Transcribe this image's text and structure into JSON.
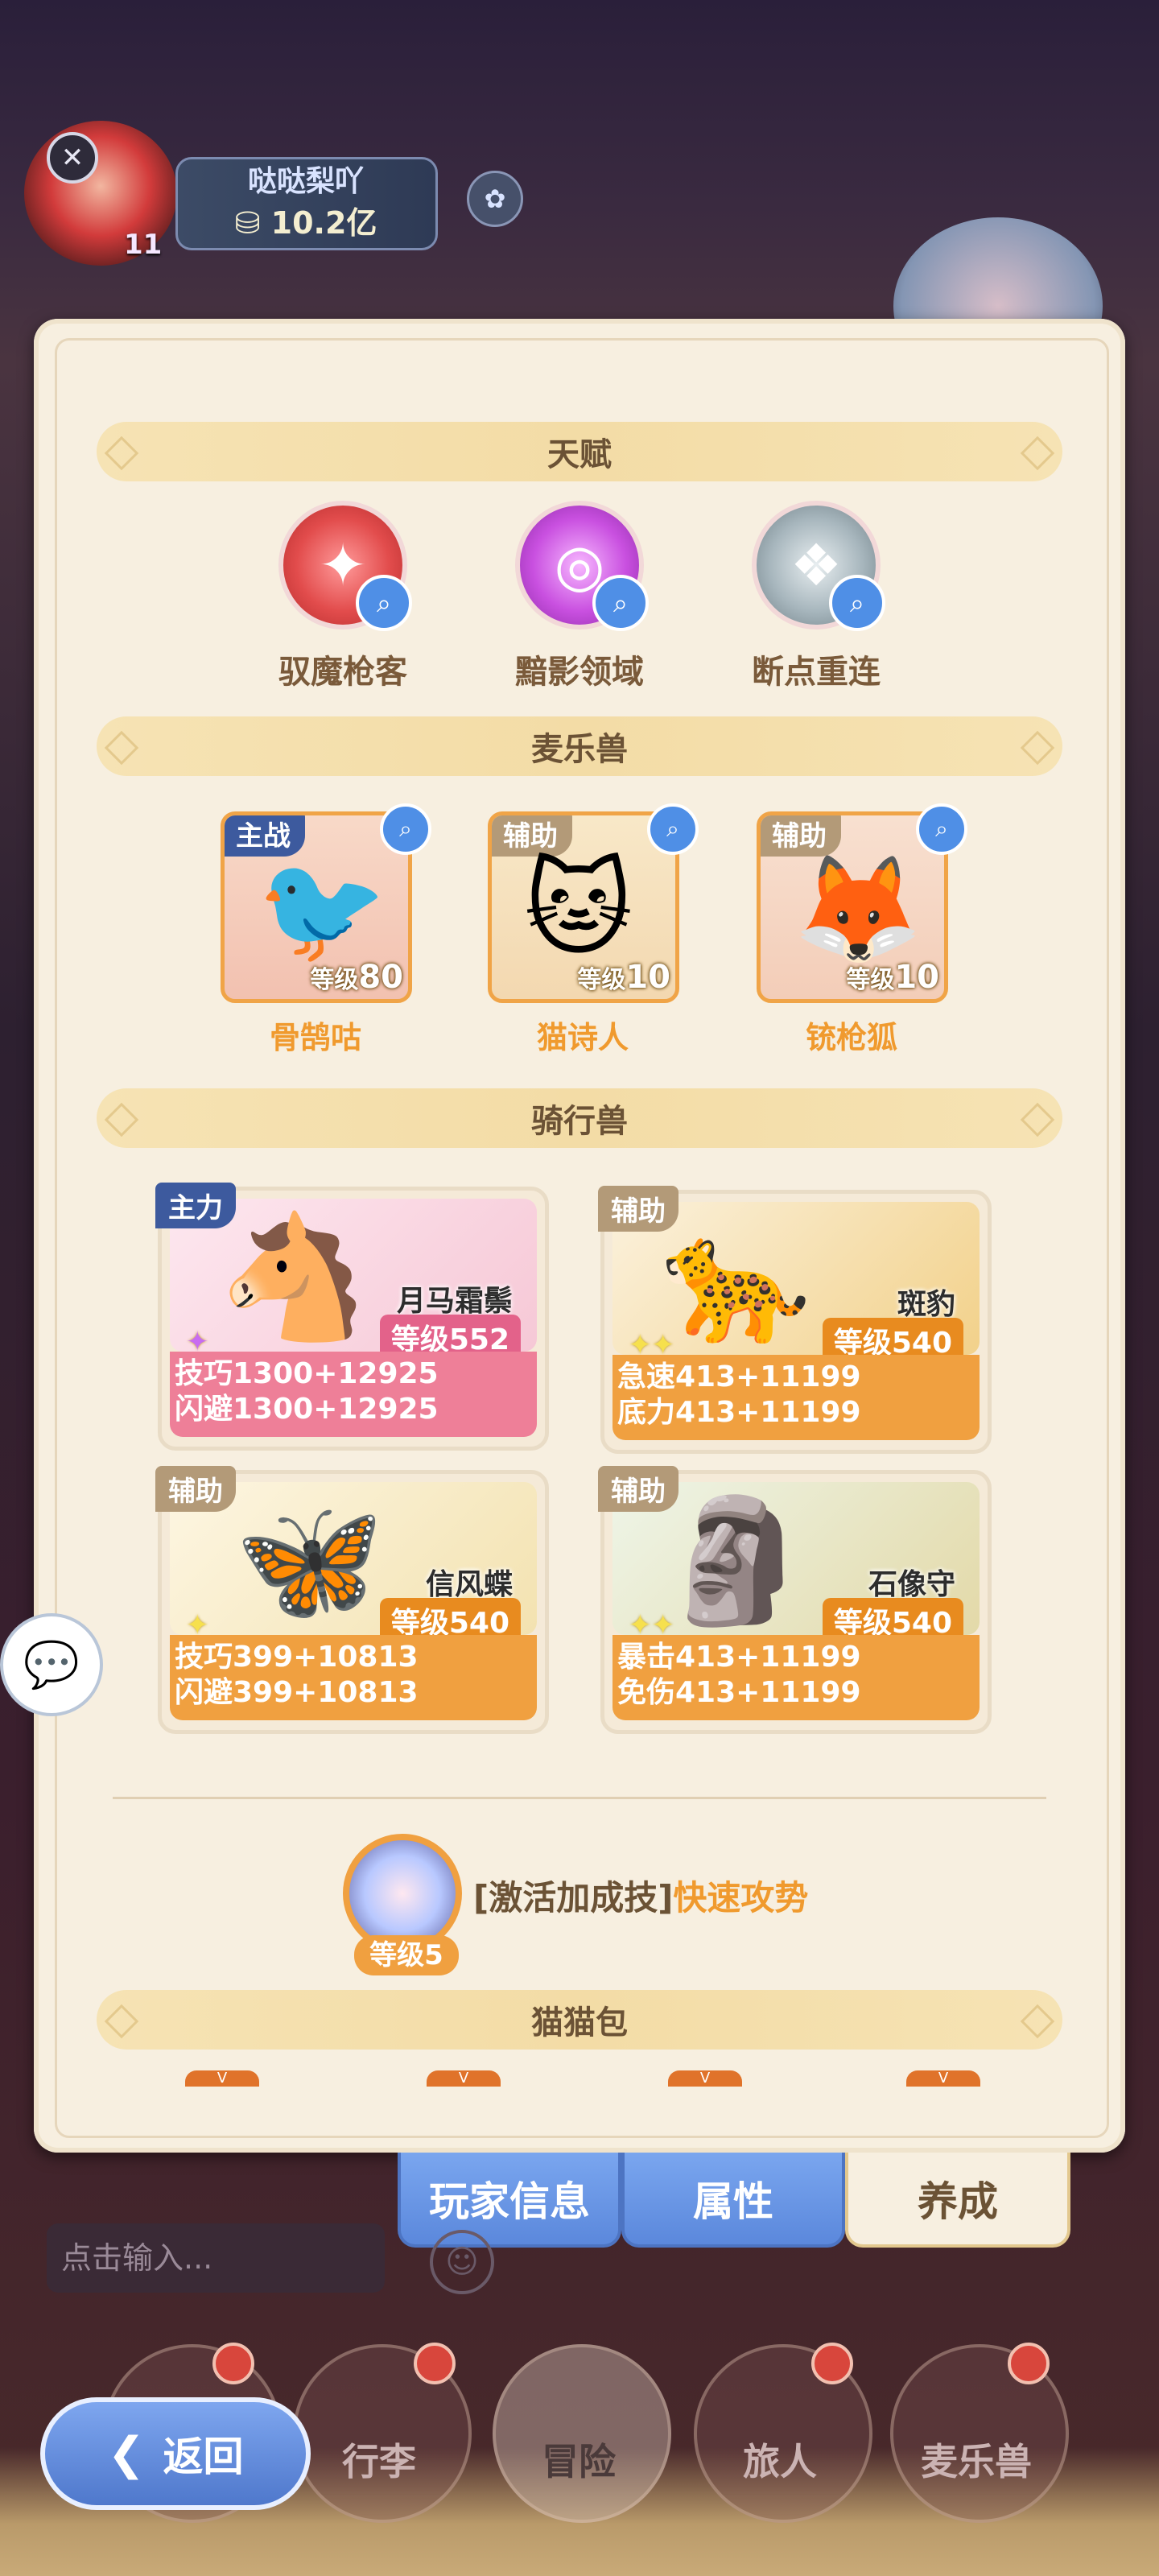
{
  "player": {
    "name": "哒哒梨吖",
    "gold": "10.2亿",
    "level": "11"
  },
  "talents": {
    "title": "天赋",
    "items": [
      {
        "name": "驭魔枪客"
      },
      {
        "name": "黯影领域"
      },
      {
        "name": "断点重连"
      }
    ]
  },
  "pets": {
    "title": "麦乐兽",
    "items": [
      {
        "role": "主战",
        "level_prefix": "等级",
        "level": "80",
        "name": "骨鹄咕"
      },
      {
        "role": "辅助",
        "level_prefix": "等级",
        "level": "10",
        "name": "猫诗人"
      },
      {
        "role": "辅助",
        "level_prefix": "等级",
        "level": "10",
        "name": "铳枪狐"
      }
    ]
  },
  "mounts": {
    "title": "骑行兽",
    "items": [
      {
        "role": "主力",
        "name": "月马霜鬃",
        "level": "等级552",
        "stat1": "技巧1300+12925",
        "stat2": "闪避1300+12925"
      },
      {
        "role": "辅助",
        "name": "斑豹",
        "level": "等级540",
        "stat1": "急速413+11199",
        "stat2": "底力413+11199"
      },
      {
        "role": "辅助",
        "name": "信风蝶",
        "level": "等级540",
        "stat1": "技巧399+10813",
        "stat2": "闪避399+10813"
      },
      {
        "role": "辅助",
        "name": "石像守",
        "level": "等级540",
        "stat1": "暴击413+11199",
        "stat2": "免伤413+11199"
      }
    ]
  },
  "skill": {
    "prefix": "[激活加成技]",
    "name": "快速攻势",
    "level": "等级5"
  },
  "bag": {
    "title": "猫猫包",
    "tab_glyph": "V"
  },
  "tabs": {
    "player_info": "玩家信息",
    "attributes": "属性",
    "cultivate": "养成"
  },
  "chat": {
    "placeholder": "点击输入..."
  },
  "nav": {
    "back": "返回",
    "luggage": "行李",
    "adventure": "冒险",
    "traveler": "旅人",
    "pets": "麦乐兽"
  }
}
